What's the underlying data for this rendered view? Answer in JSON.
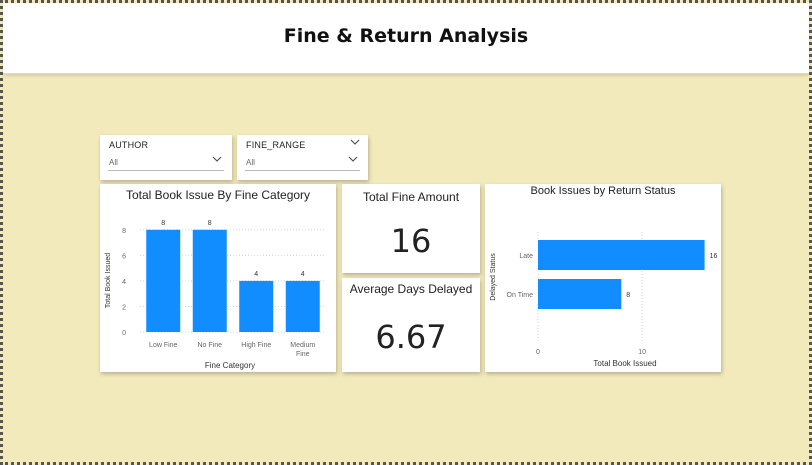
{
  "header": {
    "title": "Fine & Return Analysis"
  },
  "slicers": [
    {
      "label": "AUTHOR",
      "value": "All"
    },
    {
      "label": "FINE_RANGE",
      "value": "All"
    }
  ],
  "kpis": [
    {
      "title": "Total Fine Amount",
      "value": "16"
    },
    {
      "title": "Average Days Delayed",
      "value": "6.67"
    }
  ],
  "colors": {
    "bar": "#118DFF",
    "background": "#F3EABB"
  },
  "icons": {
    "dropdown": "chevron-down-icon"
  },
  "chart_data": [
    {
      "type": "bar",
      "title": "Total Book Issue By Fine Category",
      "xlabel": "Fine Category",
      "ylabel": "Total Book Issued",
      "categories": [
        "Low Fine",
        "No Fine",
        "High Fine",
        "Medium Fine"
      ],
      "values": [
        8,
        8,
        4,
        4
      ],
      "yticks": [
        0,
        2,
        4,
        6,
        8
      ],
      "ylim": [
        0,
        9
      ],
      "grid": true
    },
    {
      "type": "bar",
      "orientation": "horizontal",
      "title": "Book Issues by Return Status",
      "xlabel": "Total Book Issued",
      "ylabel": "Delayed Status",
      "categories": [
        "Late",
        "On Time"
      ],
      "values": [
        16,
        8
      ],
      "xticks": [
        0,
        10
      ],
      "xlim": [
        0,
        17
      ],
      "grid": true
    }
  ]
}
